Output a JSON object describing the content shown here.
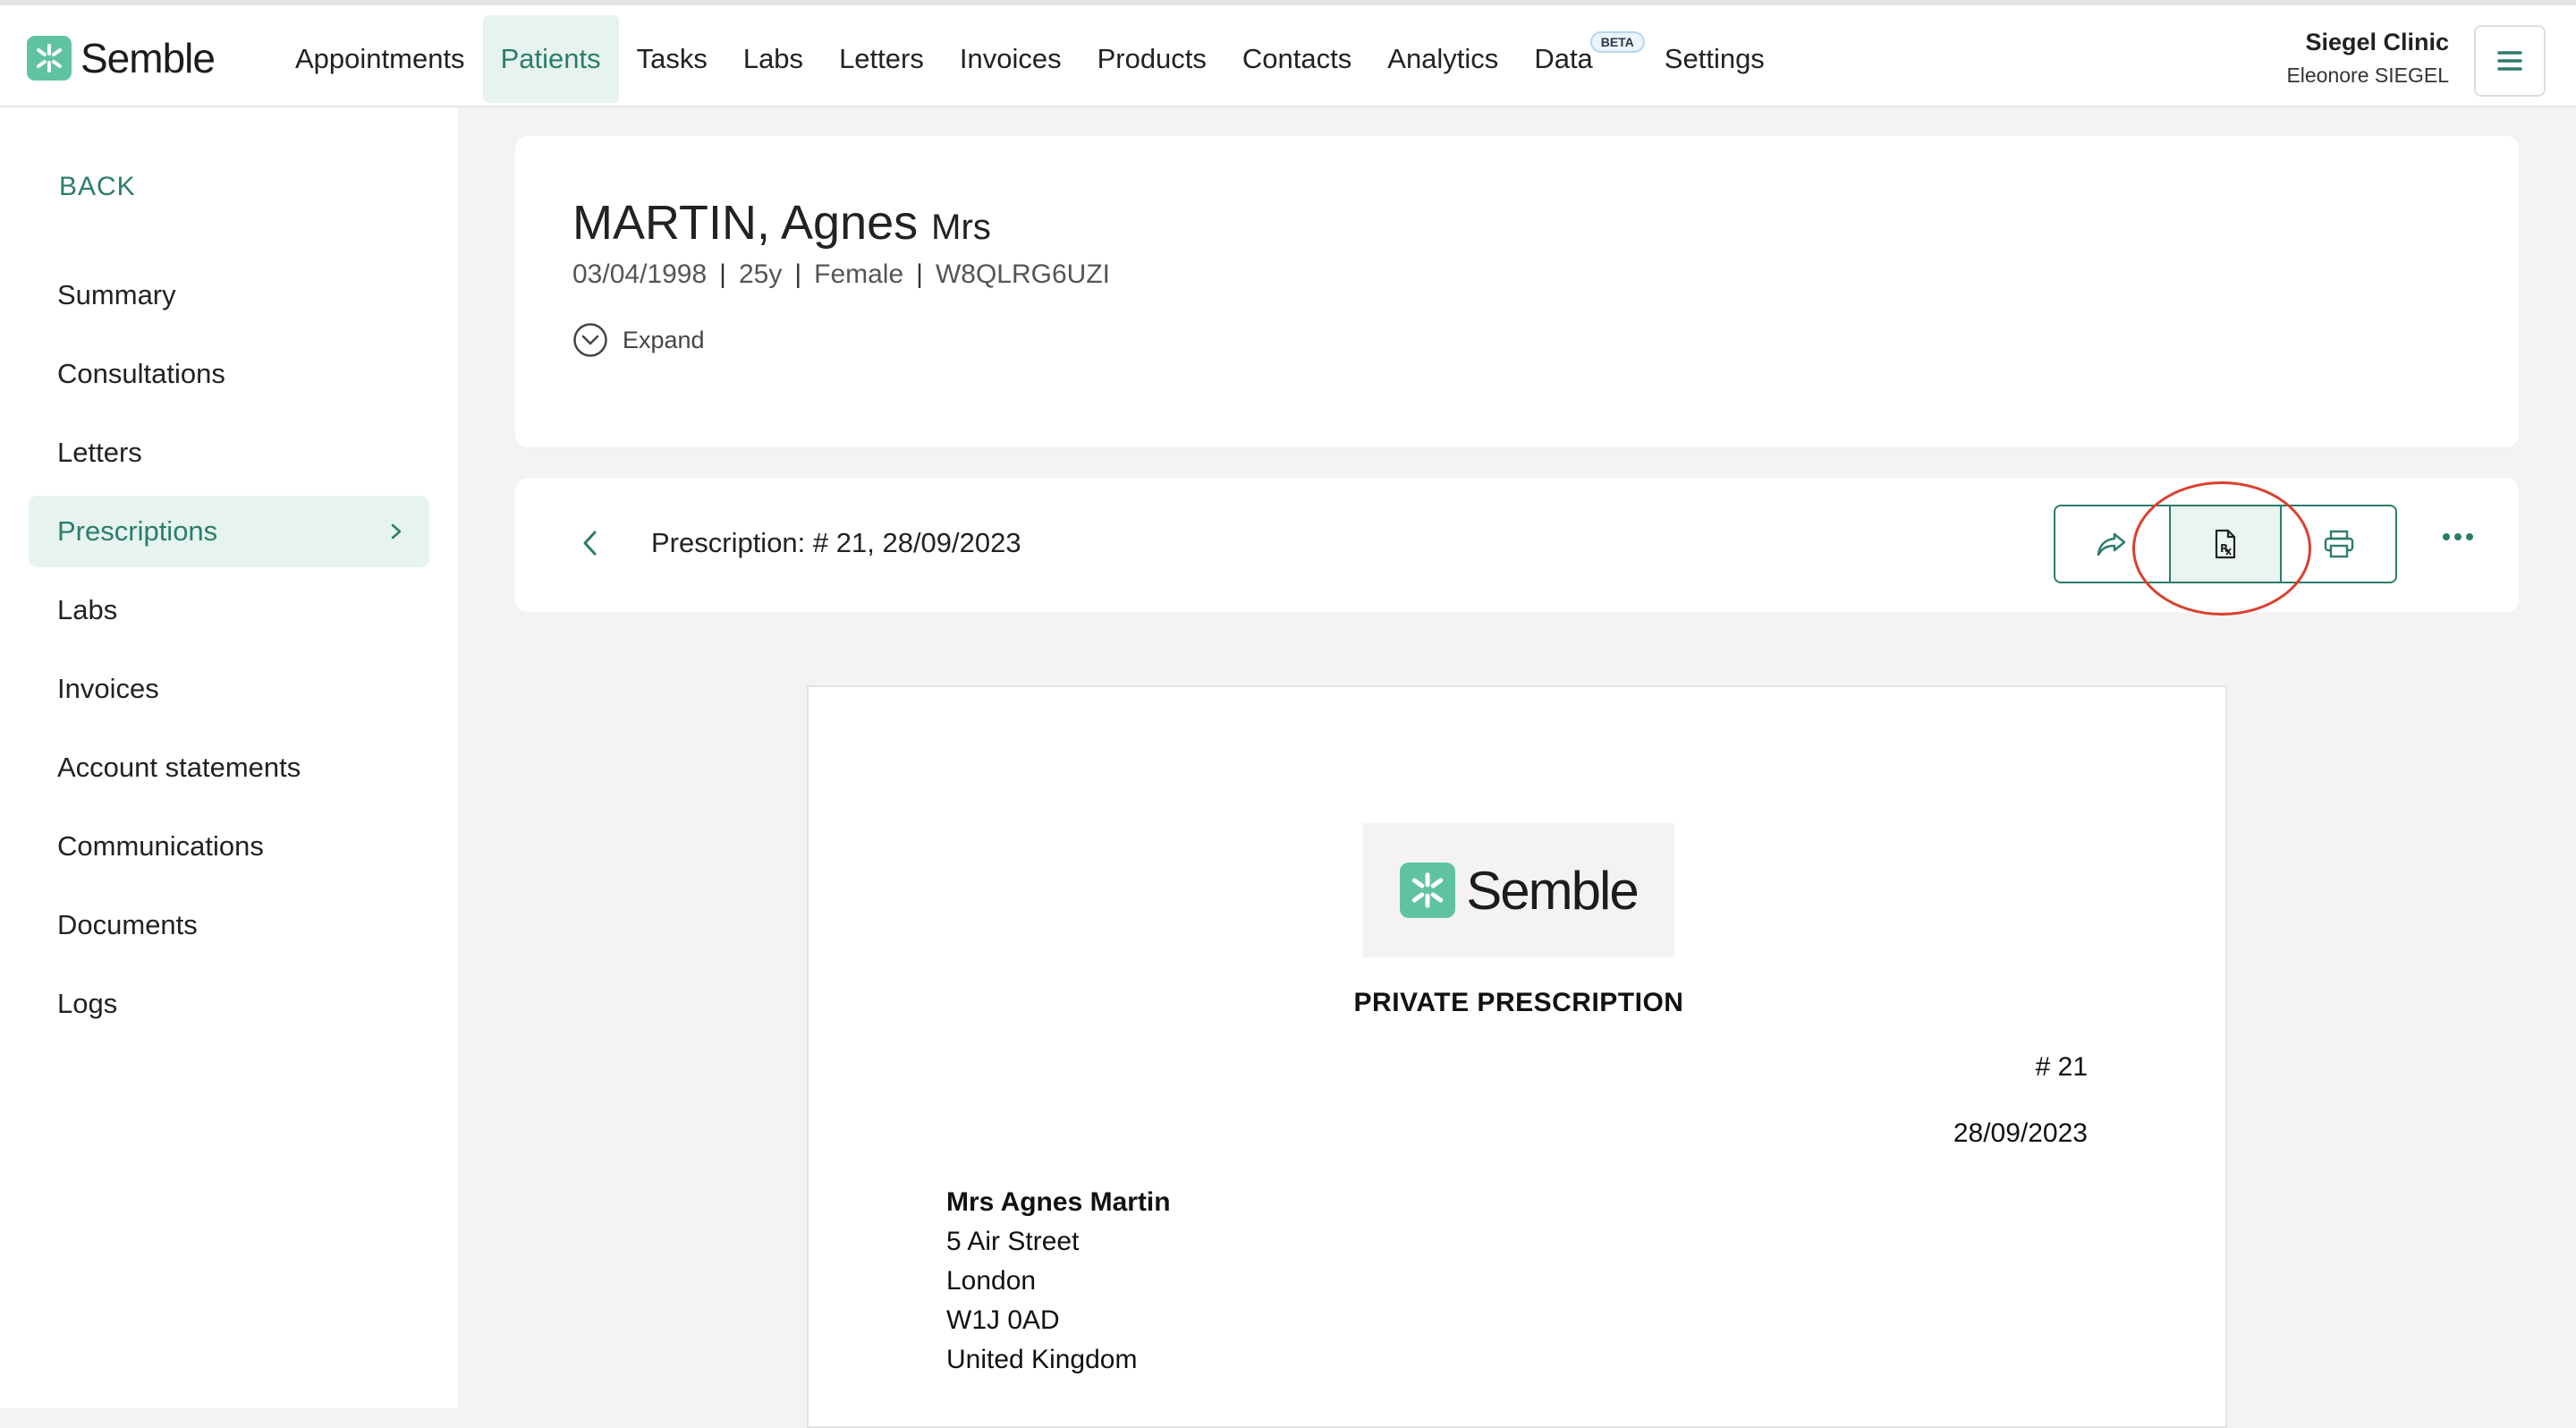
{
  "brand": {
    "name": "Semble",
    "color": "#5fc3a3"
  },
  "nav": {
    "items": [
      {
        "label": "Appointments",
        "active": false
      },
      {
        "label": "Patients",
        "active": true
      },
      {
        "label": "Tasks",
        "active": false
      },
      {
        "label": "Labs",
        "active": false
      },
      {
        "label": "Letters",
        "active": false
      },
      {
        "label": "Invoices",
        "active": false
      },
      {
        "label": "Products",
        "active": false
      },
      {
        "label": "Contacts",
        "active": false
      },
      {
        "label": "Analytics",
        "active": false
      },
      {
        "label": "Data",
        "active": false,
        "badge": "BETA"
      },
      {
        "label": "Settings",
        "active": false
      }
    ]
  },
  "clinic": {
    "name": "Siegel Clinic",
    "user": "Eleonore SIEGEL"
  },
  "sidebar": {
    "back_label": "BACK",
    "items": [
      {
        "label": "Summary"
      },
      {
        "label": "Consultations"
      },
      {
        "label": "Letters"
      },
      {
        "label": "Prescriptions",
        "active": true
      },
      {
        "label": "Labs"
      },
      {
        "label": "Invoices"
      },
      {
        "label": "Account statements"
      },
      {
        "label": "Communications"
      },
      {
        "label": "Documents"
      },
      {
        "label": "Logs"
      }
    ]
  },
  "patient": {
    "name": "MARTIN, Agnes",
    "title": "Mrs",
    "dob": "03/04/1998",
    "age": "25y",
    "sex": "Female",
    "id": "W8QLRG6UZI",
    "expand_label": "Expand"
  },
  "prescription_bar": {
    "title": "Prescription: # 21, 28/09/2023",
    "actions": [
      "share-icon",
      "prescription-file-icon",
      "printer-icon"
    ]
  },
  "document": {
    "logo_text": "Semble",
    "heading": "PRIVATE PRESCRIPTION",
    "number": "# 21",
    "date": "28/09/2023",
    "address": {
      "name": "Mrs Agnes Martin",
      "line1": "5 Air Street",
      "city": "London",
      "postcode": "W1J 0AD",
      "country": "United Kingdom"
    }
  },
  "colors": {
    "accent": "#2b7d6b",
    "active_bg": "#e6f3ef",
    "highlight": "#d9402f"
  }
}
